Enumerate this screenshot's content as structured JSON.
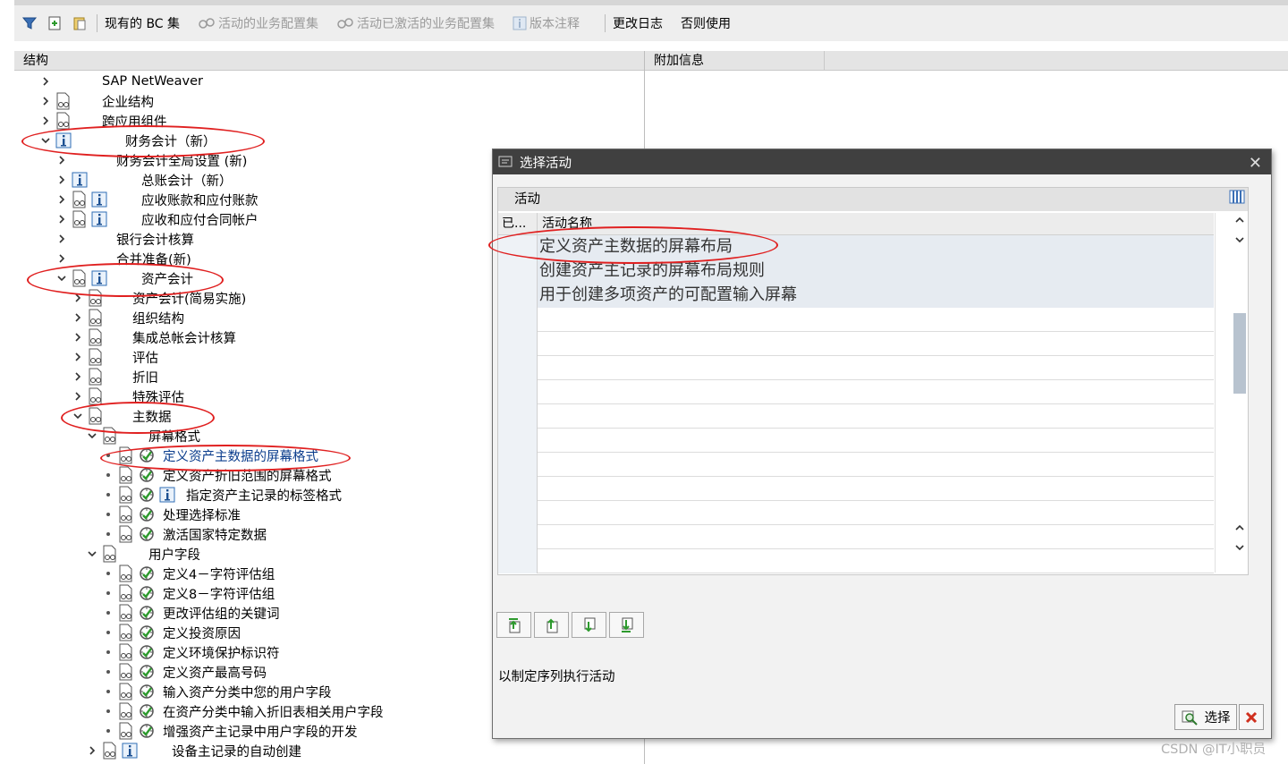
{
  "toolbar": {
    "current_bc": "现有的 BC 集",
    "active_cfg": "活动的业务配置集",
    "activated_cfg": "活动已激活的业务配置集",
    "release_notes": "版本注释",
    "change_log": "更改日志",
    "otherwise_use": "否则使用"
  },
  "panes": {
    "structure_header": "结构",
    "additional_info_header": "附加信息"
  },
  "tree": {
    "items": [
      {
        "label": "SAP NetWeaver",
        "expander": "collapsed",
        "icons": []
      },
      {
        "label": "企业结构",
        "expander": "collapsed",
        "icons": [
          "glasses-doc-icon"
        ]
      },
      {
        "label": "跨应用组件",
        "expander": "collapsed",
        "icons": [
          "glasses-doc-icon"
        ]
      },
      {
        "label": "财务会计（新）",
        "expander": "expanded",
        "icons": [
          "info-icon"
        ]
      },
      {
        "label": "财务会计全局设置 (新)",
        "expander": "collapsed",
        "icons": []
      },
      {
        "label": "总账会计（新）",
        "expander": "collapsed",
        "icons": [
          "info-icon"
        ]
      },
      {
        "label": "应收账款和应付账款",
        "expander": "collapsed",
        "icons": [
          "glasses-doc-icon",
          "info-icon"
        ]
      },
      {
        "label": "应收和应付合同帐户",
        "expander": "collapsed",
        "icons": [
          "glasses-doc-icon",
          "info-icon"
        ]
      },
      {
        "label": "银行会计核算",
        "expander": "collapsed",
        "icons": []
      },
      {
        "label": "合并准备(新)",
        "expander": "collapsed",
        "icons": []
      },
      {
        "label": "资产会计",
        "expander": "expanded",
        "icons": [
          "glasses-doc-icon",
          "info-icon"
        ]
      },
      {
        "label": "资产会计(简易实施)",
        "expander": "collapsed",
        "icons": [
          "glasses-doc-icon"
        ]
      },
      {
        "label": "组织结构",
        "expander": "collapsed",
        "icons": [
          "glasses-doc-icon"
        ]
      },
      {
        "label": "集成总帐会计核算",
        "expander": "collapsed",
        "icons": [
          "glasses-doc-icon"
        ]
      },
      {
        "label": "评估",
        "expander": "collapsed",
        "icons": [
          "glasses-doc-icon"
        ]
      },
      {
        "label": "折旧",
        "expander": "collapsed",
        "icons": [
          "glasses-doc-icon"
        ]
      },
      {
        "label": "特殊评估",
        "expander": "collapsed",
        "icons": [
          "glasses-doc-icon"
        ]
      },
      {
        "label": "主数据",
        "expander": "expanded",
        "icons": [
          "glasses-doc-icon"
        ]
      },
      {
        "label": "屏幕格式",
        "expander": "expanded",
        "icons": [
          "glasses-doc-icon"
        ]
      },
      {
        "label": "定义资产主数据的屏幕格式",
        "expander": "leaf",
        "icons": [
          "glasses-doc-icon",
          "execute-icon"
        ]
      },
      {
        "label": "定义资产折旧范围的屏幕格式",
        "expander": "leaf",
        "icons": [
          "glasses-doc-icon",
          "execute-icon"
        ]
      },
      {
        "label": "指定资产主记录的标签格式",
        "expander": "leaf",
        "icons": [
          "glasses-doc-icon",
          "execute-icon",
          "info-icon"
        ]
      },
      {
        "label": "处理选择标准",
        "expander": "leaf",
        "icons": [
          "glasses-doc-icon",
          "execute-icon"
        ]
      },
      {
        "label": "激活国家特定数据",
        "expander": "leaf",
        "icons": [
          "glasses-doc-icon",
          "execute-icon"
        ]
      },
      {
        "label": "用户字段",
        "expander": "expanded",
        "icons": [
          "glasses-doc-icon"
        ]
      },
      {
        "label": "定义4－字符评估组",
        "expander": "leaf",
        "icons": [
          "glasses-doc-icon",
          "execute-icon"
        ]
      },
      {
        "label": "定义8－字符评估组",
        "expander": "leaf",
        "icons": [
          "glasses-doc-icon",
          "execute-icon"
        ]
      },
      {
        "label": "更改评估组的关键词",
        "expander": "leaf",
        "icons": [
          "glasses-doc-icon",
          "execute-icon"
        ]
      },
      {
        "label": "定义投资原因",
        "expander": "leaf",
        "icons": [
          "glasses-doc-icon",
          "execute-icon"
        ]
      },
      {
        "label": "定义环境保护标识符",
        "expander": "leaf",
        "icons": [
          "glasses-doc-icon",
          "execute-icon"
        ]
      },
      {
        "label": "定义资产最高号码",
        "expander": "leaf",
        "icons": [
          "glasses-doc-icon",
          "execute-icon"
        ]
      },
      {
        "label": "输入资产分类中您的用户字段",
        "expander": "leaf",
        "icons": [
          "glasses-doc-icon",
          "execute-icon"
        ]
      },
      {
        "label": "在资产分类中输入折旧表相关用户字段",
        "expander": "leaf",
        "icons": [
          "glasses-doc-icon",
          "execute-icon"
        ]
      },
      {
        "label": "增强资产主记录中用户字段的开发",
        "expander": "leaf",
        "icons": [
          "glasses-doc-icon",
          "execute-icon"
        ]
      },
      {
        "label": "设备主记录的自动创建",
        "expander": "collapsed",
        "icons": [
          "glasses-doc-icon",
          "info-icon"
        ]
      }
    ]
  },
  "dialog": {
    "title": "选择活动",
    "grid_title": "活动",
    "col_done": "已...",
    "col_name": "活动名称",
    "rows": [
      "定义资产主数据的屏幕布局",
      "创建资产主记录的屏幕布局规则",
      "用于创建多项资产的可配置输入屏幕"
    ],
    "message": "以制定序列执行活动",
    "select_button": "选择"
  },
  "watermark": "CSDN @IT小职员",
  "colors": {
    "annotation": "#e02020",
    "dialog_title_bg": "#404040",
    "link_blue": "#0a3c8c"
  }
}
